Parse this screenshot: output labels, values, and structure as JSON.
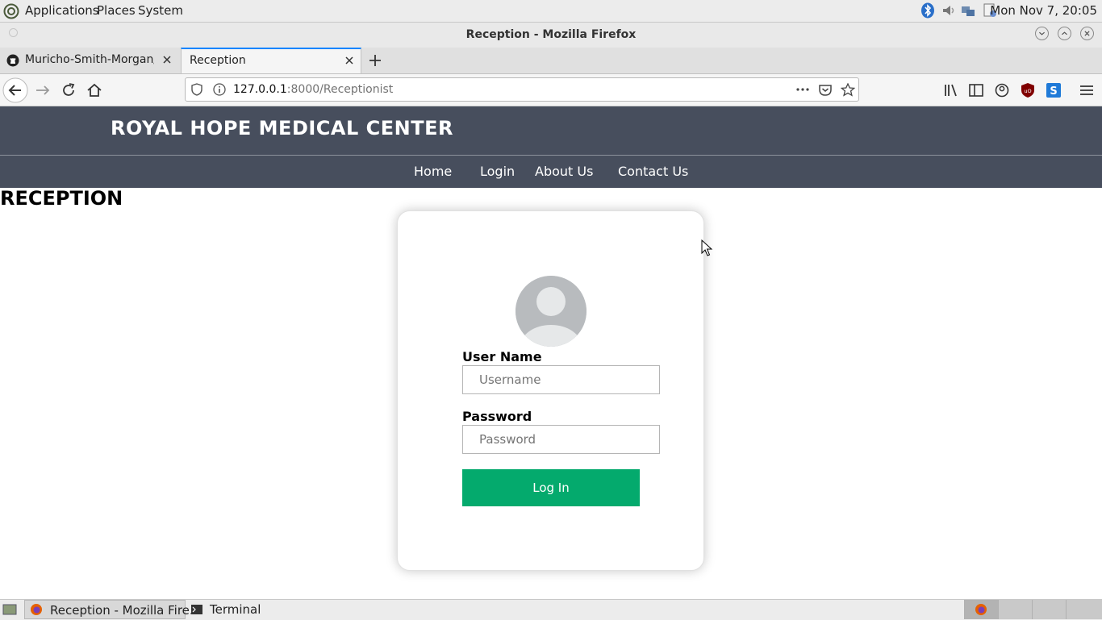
{
  "os_panel": {
    "menus": [
      "Applications",
      "Places",
      "System"
    ],
    "clock": "Mon Nov 7, 20:05"
  },
  "window": {
    "title": "Reception - Mozilla Firefox"
  },
  "tabs": [
    {
      "label": "Muricho-Smith-Morgan/"
    },
    {
      "label": "Reception"
    }
  ],
  "url": {
    "host": "127.0.0.1",
    "rest": ":8000/Receptionist"
  },
  "site": {
    "title": "ROYAL HOPE MEDICAL CENTER",
    "nav": [
      "Home",
      "Login",
      "About Us",
      "Contact Us"
    ],
    "heading": "RECEPTION"
  },
  "login": {
    "username_label": "User Name",
    "username_placeholder": "Username",
    "password_label": "Password",
    "password_placeholder": "Password",
    "submit_label": "Log In"
  },
  "taskbar": {
    "items": [
      "Reception - Mozilla Fire...",
      "Terminal"
    ]
  },
  "colors": {
    "header_bg": "#474e5d",
    "button_bg": "#04aa6d",
    "accent": "#0a84ff"
  }
}
